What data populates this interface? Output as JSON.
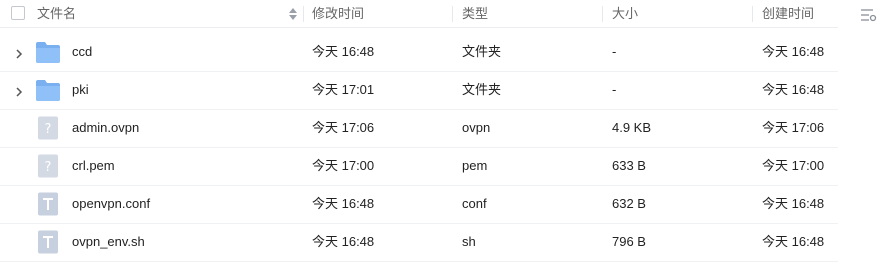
{
  "header": {
    "name": "文件名",
    "mtime": "修改时间",
    "type": "类型",
    "size": "大小",
    "ctime": "创建时间"
  },
  "rows": [
    {
      "name": "ccd",
      "mtime": "今天 16:48",
      "type": "文件夹",
      "size": "-",
      "ctime": "今天 16:48",
      "icon": "folder-icon",
      "expandable": true
    },
    {
      "name": "pki",
      "mtime": "今天 17:01",
      "type": "文件夹",
      "size": "-",
      "ctime": "今天 16:48",
      "icon": "folder-icon",
      "expandable": true
    },
    {
      "name": "admin.ovpn",
      "mtime": "今天 17:06",
      "type": "ovpn",
      "size": "4.9 KB",
      "ctime": "今天 17:06",
      "icon": "unknown-file-icon",
      "expandable": false
    },
    {
      "name": "crl.pem",
      "mtime": "今天 17:00",
      "type": "pem",
      "size": "633 B",
      "ctime": "今天 17:00",
      "icon": "unknown-file-icon",
      "expandable": false
    },
    {
      "name": "openvpn.conf",
      "mtime": "今天 16:48",
      "type": "conf",
      "size": "632 B",
      "ctime": "今天 16:48",
      "icon": "text-file-icon",
      "expandable": false
    },
    {
      "name": "ovpn_env.sh",
      "mtime": "今天 16:48",
      "type": "sh",
      "size": "796 B",
      "ctime": "今天 16:48",
      "icon": "text-file-icon",
      "expandable": false
    }
  ]
}
